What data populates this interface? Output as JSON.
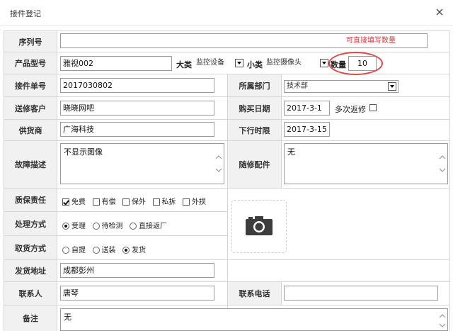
{
  "dialog": {
    "title": "接件登记"
  },
  "form": {
    "serial": {
      "label": "序列号",
      "value": "",
      "placeholder": "可直接填写数量"
    },
    "product": {
      "label": "产品型号",
      "model": "雅视002",
      "category_label": "大类",
      "category_value": "监控设备",
      "subcategory_label": "小类",
      "subcategory_value": "监控摄像头",
      "qty_label": "数量",
      "qty_value": "10"
    },
    "order": {
      "label": "接件单号",
      "value": "2017030802"
    },
    "department": {
      "label": "所属部门",
      "value": "技术部"
    },
    "customer": {
      "label": "送修客户",
      "value": "晓晓网吧"
    },
    "purchase_date": {
      "label": "购买日期",
      "value": "2017-3-1",
      "multi_label": "多次返修"
    },
    "supplier": {
      "label": "供货商",
      "value": "广海科技"
    },
    "deadline": {
      "label": "下行时限",
      "value": "2017-3-15"
    },
    "fault": {
      "label": "故障描述",
      "value": "不显示图像"
    },
    "accessories": {
      "label": "随修配件",
      "value": "无"
    },
    "warranty": {
      "label": "质保责任",
      "options": [
        "免费",
        "有偿",
        "保外",
        "私拆",
        "外损"
      ],
      "checked": "免费"
    },
    "process": {
      "label": "处理方式",
      "options": [
        "受理",
        "待检测",
        "直接返厂"
      ],
      "selected": "受理"
    },
    "pickup": {
      "label": "取货方式",
      "options": [
        "自提",
        "送装",
        "发货"
      ],
      "selected": "发货"
    },
    "ship_address": {
      "label": "发货地址",
      "value": "成都彭州"
    },
    "contact": {
      "label": "联系人",
      "value": "唐琴"
    },
    "phone": {
      "label": "联系电话",
      "value": ""
    },
    "remark": {
      "label": "备注",
      "value": "无"
    }
  },
  "colors": {
    "annotation": "#e04848",
    "hint": "#d93636",
    "label_bg": "#f1f1f1"
  }
}
